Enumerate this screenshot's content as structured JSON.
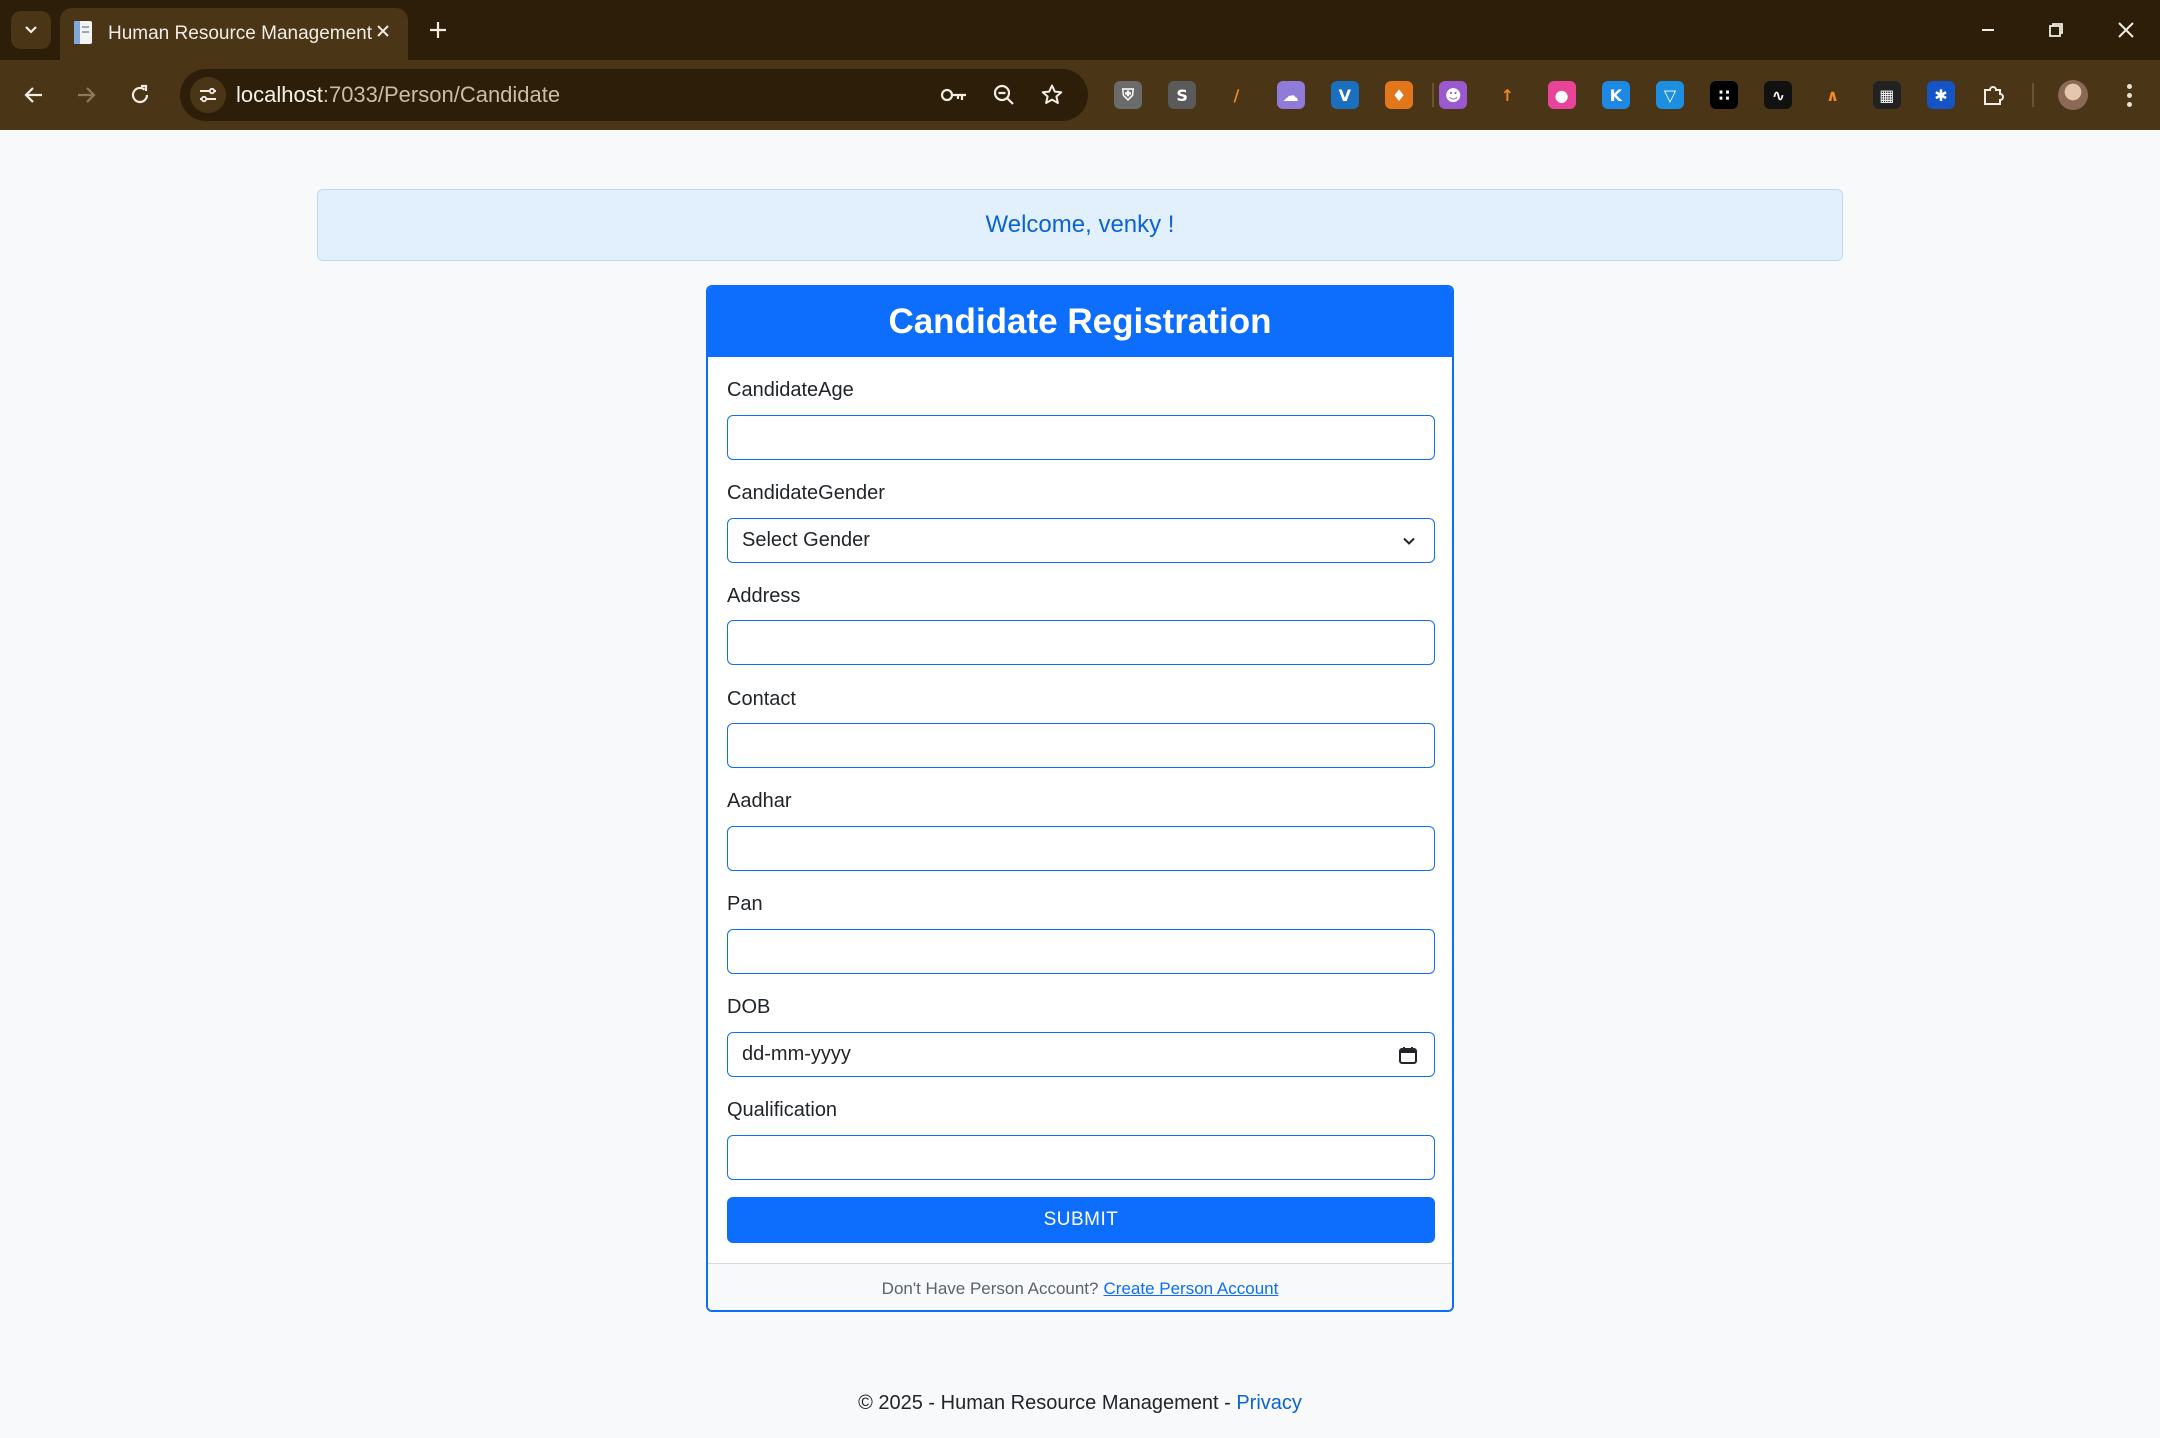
{
  "browser": {
    "tab_title": "Human Resource Management",
    "url_host": "localhost",
    "url_path": ":7033/Person/Candidate",
    "extensions": [
      {
        "name": "shield-extension-icon",
        "color": "#6b6b6b",
        "glyph": "⛨"
      },
      {
        "name": "s-extension-icon",
        "color": "#5a5a5a",
        "glyph": "S"
      },
      {
        "name": "lines-extension-icon",
        "color": "transparent",
        "glyph": "∕"
      },
      {
        "name": "cloud-extension-icon",
        "color": "#8f7bd8",
        "glyph": "☁"
      },
      {
        "name": "v-extension-icon",
        "color": "#1a6fbf",
        "glyph": "V"
      },
      {
        "name": "fox-extension-icon",
        "color": "#e2761b",
        "glyph": "♦"
      },
      {
        "name": "robot-extension-icon",
        "color": "#9b59d0",
        "glyph": "☻"
      },
      {
        "name": "chart-extension-icon",
        "color": "transparent",
        "glyph": "↑"
      },
      {
        "name": "pink-extension-icon",
        "color": "#e8449a",
        "glyph": "●"
      },
      {
        "name": "k-extension-icon",
        "color": "#1e88e5",
        "glyph": "K"
      },
      {
        "name": "t-extension-icon",
        "color": "#1d8fe0",
        "glyph": "▽"
      },
      {
        "name": "grid-extension-icon",
        "color": "#000000",
        "glyph": "∷"
      },
      {
        "name": "wave-extension-icon",
        "color": "#111111",
        "glyph": "∿"
      },
      {
        "name": "ai-extension-icon",
        "color": "transparent",
        "glyph": "∧"
      },
      {
        "name": "qr-extension-icon",
        "color": "#222222",
        "glyph": "▦"
      },
      {
        "name": "star-extension-icon",
        "color": "#1554c4",
        "glyph": "✱"
      }
    ]
  },
  "alert": {
    "text": "Welcome, venky !"
  },
  "form": {
    "title": "Candidate Registration",
    "fields": {
      "age": {
        "label": "CandidateAge",
        "value": ""
      },
      "gender": {
        "label": "CandidateGender",
        "selected": "Select Gender"
      },
      "address": {
        "label": "Address",
        "value": ""
      },
      "contact": {
        "label": "Contact",
        "value": ""
      },
      "aadhar": {
        "label": "Aadhar",
        "value": ""
      },
      "pan": {
        "label": "Pan",
        "value": ""
      },
      "dob": {
        "label": "DOB",
        "value": "dd-mm-yyyy"
      },
      "qualification": {
        "label": "Qualification",
        "value": ""
      }
    },
    "submit_label": "SUBMIT",
    "footer_text": "Don't Have Person Account?",
    "footer_link": "Create Person Account"
  },
  "footer": {
    "text": "© 2025 - Human Resource Management -",
    "link": "Privacy"
  }
}
